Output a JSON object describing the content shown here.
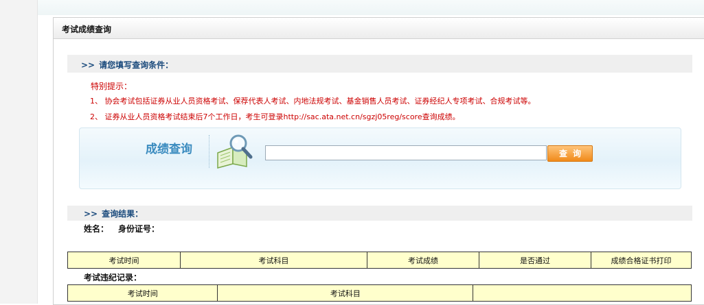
{
  "panel": {
    "title": "考试成绩查询"
  },
  "conditions": {
    "chevron": ">>",
    "title": "请您填写查询条件："
  },
  "notice": {
    "heading": "特别提示：",
    "items": [
      "1、  协会考试包括证券从业人员资格考试、保荐代表人考试、内地法规考试、基金销售人员考试、证券经纪人专项考试、合规考试等。",
      "2、  证券从业人员资格考试结束后7个工作日，考生可登录http://sac.ata.net.cn/sgzj05reg/score查询成绩。"
    ]
  },
  "search": {
    "label": "成绩查询",
    "input_value": "",
    "button_label": "查询"
  },
  "results": {
    "chevron": ">>",
    "title": "查询结果：",
    "name_label": "姓名：",
    "id_label": "身份证号："
  },
  "results_table": {
    "headers": [
      "考试时间",
      "考试科目",
      "考试成绩",
      "是否通过",
      "成绩合格证书打印"
    ]
  },
  "violations": {
    "title": "考试违纪记录：",
    "headers": [
      "考试时间",
      "考试科目",
      ""
    ]
  },
  "colors": {
    "accent_blue": "#1a4a7c",
    "notice_red": "#cc0000",
    "button_orange": "#f08a1a",
    "table_fill": "#ffffcc"
  }
}
